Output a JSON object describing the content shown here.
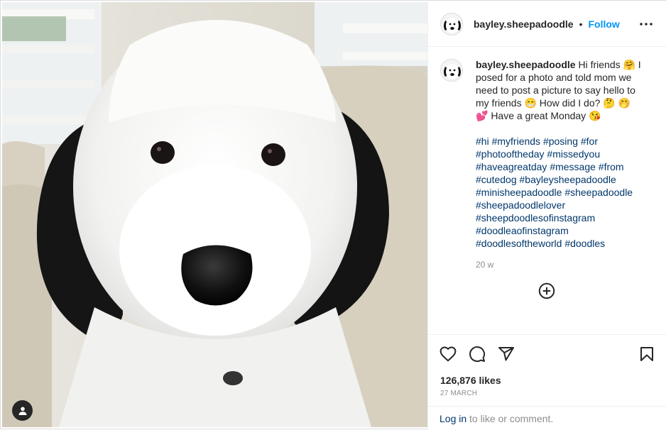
{
  "post": {
    "image_alt": "Sheepadoodle dog portrait",
    "tag_icon": "user-tag-icon"
  },
  "header": {
    "username": "bayley.sheepadoodle",
    "separator": "•",
    "follow_label": "Follow",
    "more_icon": "more-options-icon"
  },
  "caption": {
    "username": "bayley.sheepadoodle",
    "text": "Hi friends 🤗 I posed for a photo and told mom we need to post a picture to say hello to my friends 😁 How did I do? 🤔 🤭 💕 Have a great Monday 😘",
    "hashtags": [
      "#hi",
      "#myfriends",
      "#posing",
      "#for",
      "#photooftheday",
      "#missedyou",
      "#haveagreatday",
      "#message",
      "#from",
      "#cutedog",
      "#bayleysheepadoodle",
      "#minisheepadoodle",
      "#sheepadoodle",
      "#sheepadoodlelover",
      "#sheepdoodlesofinstagram",
      "#doodleaofinstagram",
      "#doodlesoftheworld",
      "#doodles"
    ],
    "time": "20 w"
  },
  "load_more_icon": "plus-circle-icon",
  "actions": {
    "like_icon": "heart-icon",
    "comment_icon": "comment-icon",
    "share_icon": "share-icon",
    "save_icon": "bookmark-icon"
  },
  "likes": "126,876 likes",
  "date": "27 MARCH",
  "comment_bar": {
    "login_label": "Log in",
    "rest_text": " to like or comment."
  },
  "colors": {
    "accent": "#0095f6",
    "hashtag": "#00376b",
    "muted": "#8e8e8e",
    "border": "#dbdbdb"
  }
}
